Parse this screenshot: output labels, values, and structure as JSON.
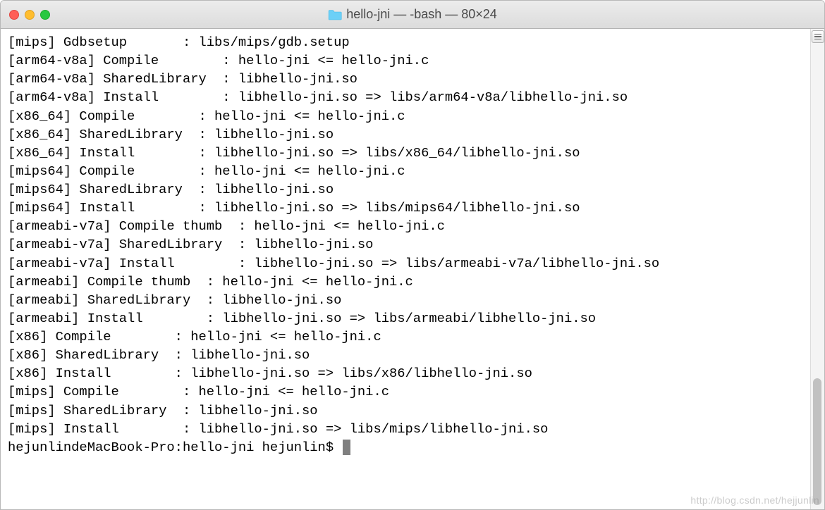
{
  "window": {
    "title": "hello-jni — -bash — 80×24"
  },
  "terminal": {
    "lines": [
      "[mips] Gdbsetup       : libs/mips/gdb.setup",
      "[arm64-v8a] Compile        : hello-jni <= hello-jni.c",
      "[arm64-v8a] SharedLibrary  : libhello-jni.so",
      "[arm64-v8a] Install        : libhello-jni.so => libs/arm64-v8a/libhello-jni.so",
      "[x86_64] Compile        : hello-jni <= hello-jni.c",
      "[x86_64] SharedLibrary  : libhello-jni.so",
      "[x86_64] Install        : libhello-jni.so => libs/x86_64/libhello-jni.so",
      "[mips64] Compile        : hello-jni <= hello-jni.c",
      "[mips64] SharedLibrary  : libhello-jni.so",
      "[mips64] Install        : libhello-jni.so => libs/mips64/libhello-jni.so",
      "[armeabi-v7a] Compile thumb  : hello-jni <= hello-jni.c",
      "[armeabi-v7a] SharedLibrary  : libhello-jni.so",
      "[armeabi-v7a] Install        : libhello-jni.so => libs/armeabi-v7a/libhello-jni.so",
      "[armeabi] Compile thumb  : hello-jni <= hello-jni.c",
      "[armeabi] SharedLibrary  : libhello-jni.so",
      "[armeabi] Install        : libhello-jni.so => libs/armeabi/libhello-jni.so",
      "[x86] Compile        : hello-jni <= hello-jni.c",
      "[x86] SharedLibrary  : libhello-jni.so",
      "[x86] Install        : libhello-jni.so => libs/x86/libhello-jni.so",
      "[mips] Compile        : hello-jni <= hello-jni.c",
      "[mips] SharedLibrary  : libhello-jni.so",
      "[mips] Install        : libhello-jni.so => libs/mips/libhello-jni.so"
    ],
    "prompt": "hejunlindeMacBook-Pro:hello-jni hejunlin$ "
  },
  "watermark": "http://blog.csdn.net/hejjunlin"
}
